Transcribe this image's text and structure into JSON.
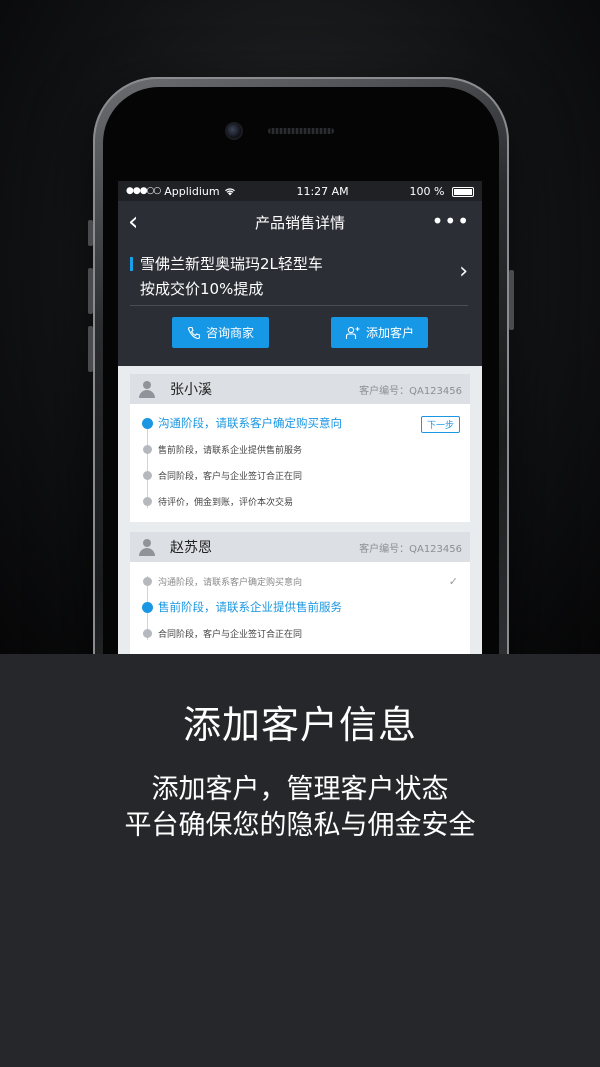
{
  "status_bar": {
    "carrier": "Applidium",
    "time": "11:27 AM",
    "battery": "100 %"
  },
  "nav": {
    "title": "产品销售详情",
    "back": "‹",
    "more": "•••"
  },
  "product": {
    "name": "雪佛兰新型奥瑞玛2L轻型车",
    "commission": "按成交价10%提成"
  },
  "actions": {
    "consult": "咨询商家",
    "add_customer": "添加客户"
  },
  "customers": [
    {
      "name": "张小溪",
      "id_label": "客户编号：QA123456",
      "next_label": "下一步",
      "steps": [
        "沟通阶段，请联系客户确定购买意向",
        "售前阶段，请联系企业提供售前服务",
        "合同阶段，客户与企业签订合正在同",
        "待评价，佣金到账，评价本次交易"
      ]
    },
    {
      "name": "赵苏恩",
      "id_label": "客户编号：QA123456",
      "steps": [
        "沟通阶段，请联系客户确定购买意向",
        "售前阶段，请联系企业提供售前服务",
        "合同阶段，客户与企业签订合正在同"
      ]
    }
  ],
  "promo": {
    "title": "添加客户信息",
    "line1": "添加客户，管理客户状态",
    "line2": "平台确保您的隐私与佣金安全"
  },
  "colors": {
    "accent": "#1798e6",
    "dark_bg": "#26272b"
  }
}
